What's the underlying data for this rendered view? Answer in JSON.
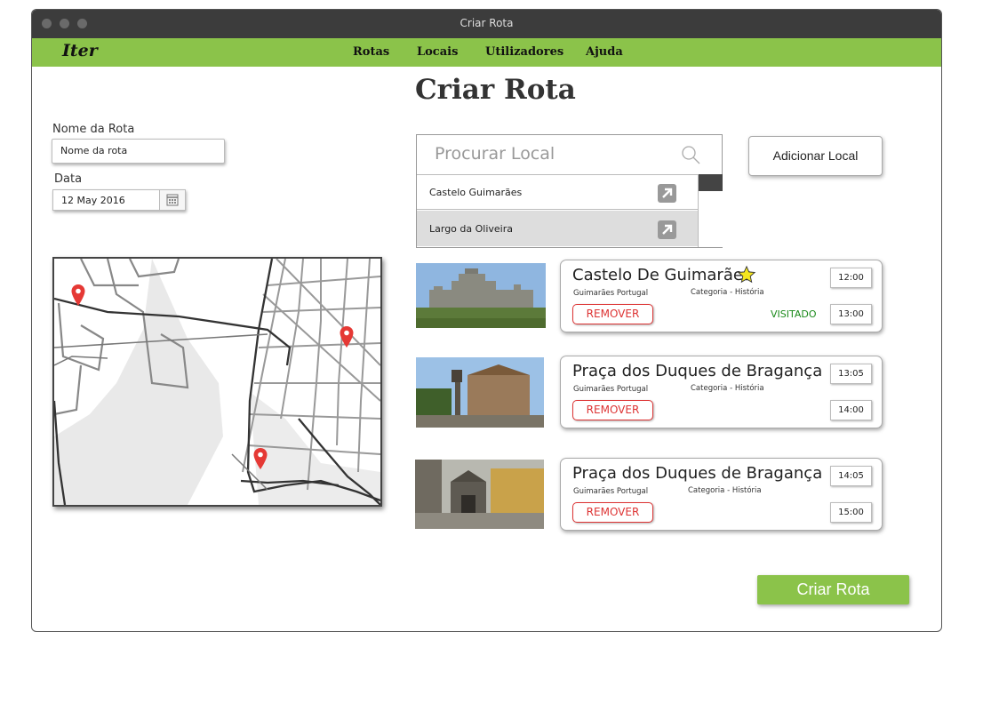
{
  "window": {
    "title": "Criar Rota"
  },
  "nav": {
    "logo": "Iter",
    "items": [
      "Rotas",
      "Locais",
      "Utilizadores",
      "Ajuda"
    ]
  },
  "page": {
    "title": "Criar Rota"
  },
  "form": {
    "name_label": "Nome da Rota",
    "name_value": "Nome da rota",
    "date_label": "Data",
    "date_value": "12 May 2016"
  },
  "search": {
    "placeholder": "Procurar Local",
    "results": [
      "Castelo Guimarães",
      "Largo da Oliveira"
    ]
  },
  "add_button": "Adicionar Local",
  "stops": [
    {
      "name": "Castelo De Guimarães",
      "location": "Guimarães Portugal",
      "category": "Categoria - História",
      "remove": "REMOVER",
      "start": "12:00",
      "end": "13:00",
      "status": "VISITADO",
      "favorite": true
    },
    {
      "name": "Praça dos Duques de Bragança",
      "location": "Guimarães Portugal",
      "category": "Categoria - História",
      "remove": "REMOVER",
      "start": "13:05",
      "end": "14:00"
    },
    {
      "name": "Praça dos Duques de Bragança",
      "location": "Guimarães Portugal",
      "category": "Categoria - História",
      "remove": "REMOVER",
      "start": "14:05",
      "end": "15:00"
    }
  ],
  "create_button": "Criar Rota",
  "colors": {
    "accent": "#8bc34a",
    "remove": "#dd3333",
    "visited": "#1a8a1a",
    "pin": "#e53935"
  }
}
